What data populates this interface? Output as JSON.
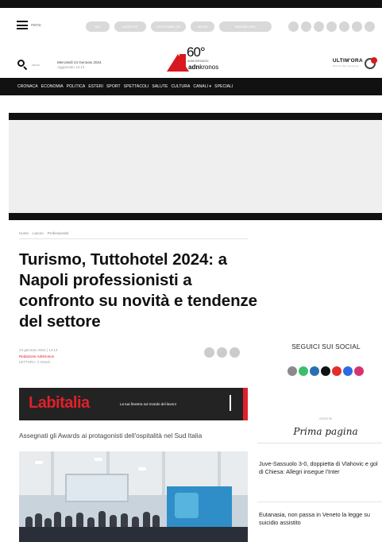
{
  "header": {
    "menu_label": "menu",
    "search_label": "cerca",
    "date": "Mercoledì 24 Gennaio 2024",
    "updated": "Aggiornato 14:13",
    "logo": {
      "number": "60°",
      "small": "ANNIVERSARIO",
      "brand_a": "adn",
      "brand_b": "kronos"
    },
    "ultimora": {
      "label": "ULTIM'ORA",
      "sub": "Notizie del momento"
    },
    "pills": [
      "AKI",
      "ADNPLUS",
      "SOSTENIBILITÀ",
      "MEDIA",
      "IMMOBILIARE"
    ]
  },
  "nav": [
    "CRONACA",
    "ECONOMIA",
    "POLITICA",
    "ESTERI",
    "SPORT",
    "SPETTACOLI",
    "SALUTE",
    "CULTURA",
    "CANALI ▾",
    "SPECIALI"
  ],
  "breadcrumb": [
    "Home",
    "Lavoro",
    "Professionisti"
  ],
  "article": {
    "title": "Turismo, Tuttohotel 2024: a Napoli professionisti a confronto su novità e tendenze del settore",
    "date": "24 gennaio 2024 | 14:13",
    "author": "Redazione Adnkronos",
    "reading": "LETTURA: 2 minuti",
    "subtitle": "Assegnati gli Awards ai protagonisti dell'ospitalità nel Sud Italia"
  },
  "banner": {
    "brand": "Labitalia",
    "tagline": "La tua finestra sul mondo del lavoro"
  },
  "sidebar": {
    "social_title": "SEGUICI SUI SOCIAL",
    "social_icons": [
      {
        "name": "threads-icon",
        "color": "#8a8a8a"
      },
      {
        "name": "whatsapp-icon",
        "color": "#3cbf6a"
      },
      {
        "name": "linkedin-icon",
        "color": "#2a6fb2"
      },
      {
        "name": "x-icon",
        "color": "#111111"
      },
      {
        "name": "youtube-icon",
        "color": "#e52d27"
      },
      {
        "name": "facebook-icon",
        "color": "#2d6ae3"
      },
      {
        "name": "instagram-icon",
        "color": "#d8336d"
      }
    ],
    "oggi": "OGGI IN",
    "prima_pagina": "Prima pagina",
    "news": [
      "Juve-Sassuolo 3-0, doppietta di Vlahovic e gol di Chiesa: Allegri insegue l'Inter",
      "Eutanasia, non passa in Veneto la legge su suicidio assistito"
    ]
  },
  "colors": {
    "accent": "#d7191f",
    "dark": "#111111"
  }
}
